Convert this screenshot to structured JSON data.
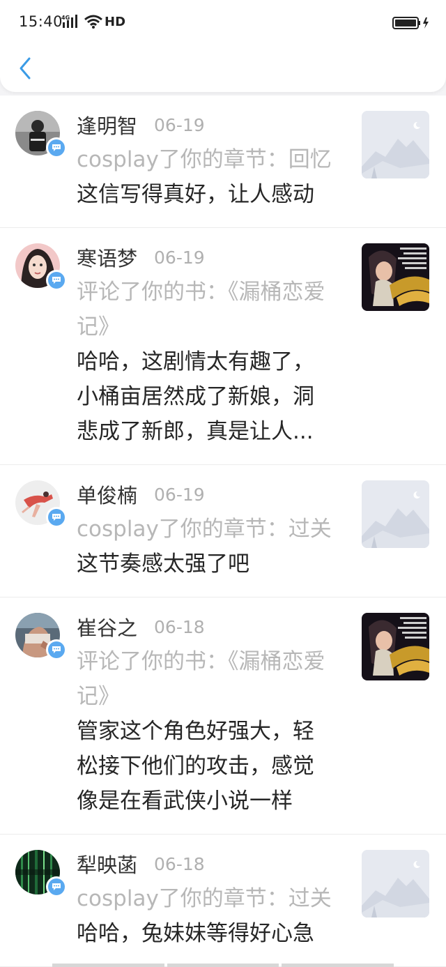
{
  "status": {
    "time": "15:40",
    "network": "4G",
    "hd": "HD"
  },
  "header": {
    "back_icon": "chevron-left-icon",
    "accent_color": "#3a9be6"
  },
  "badge_icon": "chat-bubble-icon",
  "notifications": [
    {
      "name": "逢明智",
      "date": "06-19",
      "action": "cosplay了你的章节：回忆",
      "content": "这信写得真好，让人感动",
      "thumb": "placeholder-mountain"
    },
    {
      "name": "寒语梦",
      "date": "06-19",
      "action": "评论了你的书：《漏桶恋爱记》",
      "content": "哈哈，这剧情太有趣了，小桶亩居然成了新娘，洞悲成了新郎，真是让人...",
      "thumb": "book-cover"
    },
    {
      "name": "单俊楠",
      "date": "06-19",
      "action": "cosplay了你的章节：过关",
      "content": "这节奏感太强了吧",
      "thumb": "placeholder-mountain"
    },
    {
      "name": "崔谷之",
      "date": "06-18",
      "action": "评论了你的书：《漏桶恋爱记》",
      "content": "管家这个角色好强大，轻松接下他们的攻击，感觉像是在看武侠小说一样",
      "thumb": "book-cover"
    },
    {
      "name": "犁映菡",
      "date": "06-18",
      "action": "cosplay了你的章节：过关",
      "content": "哈哈，兔妹妹等得好心急",
      "thumb": "placeholder-mountain"
    }
  ]
}
